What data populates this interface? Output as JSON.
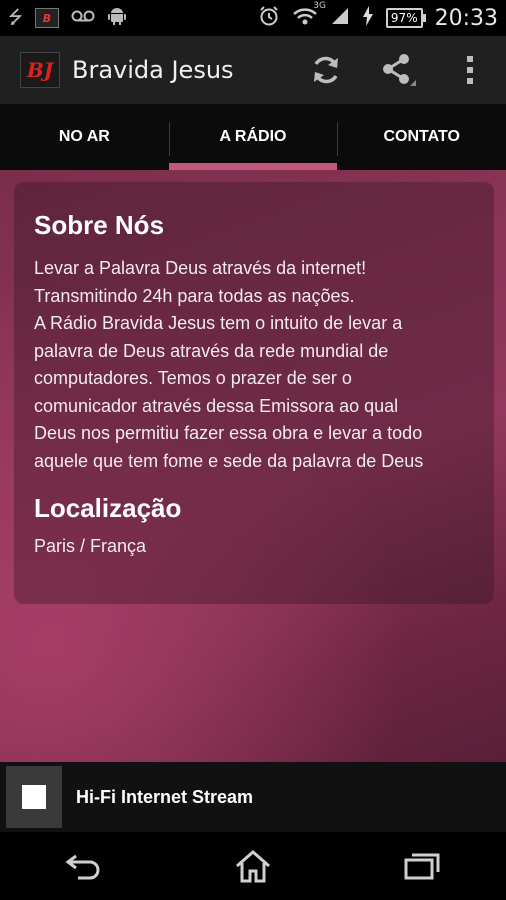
{
  "status_bar": {
    "time": "20:33",
    "battery": "97%",
    "network": "3G",
    "icons_left": [
      "usb-icon",
      "app-notification-icon",
      "voicemail-icon",
      "android-icon"
    ],
    "icons_right": [
      "alarm-icon",
      "wifi-icon",
      "signal-icon",
      "charging-icon",
      "battery-icon"
    ]
  },
  "action_bar": {
    "logo_text": "BJ",
    "title": "Bravida Jesus",
    "actions": [
      "refresh-icon",
      "share-icon",
      "overflow-menu-icon"
    ]
  },
  "tabs": [
    {
      "label": "NO AR",
      "active": false
    },
    {
      "label": "A RÁDIO",
      "active": true
    },
    {
      "label": "CONTATO",
      "active": false
    }
  ],
  "about": {
    "heading": "Sobre Nós",
    "lines": [
      "Levar a Palavra Deus através da internet!",
      "Transmitindo 24h para todas as nações.",
      "A Rádio Bravida Jesus tem o intuito de levar a",
      "palavra de Deus através da rede mundial de",
      "computadores. Temos o prazer de ser o",
      "comunicador através dessa Emissora ao qual",
      "Deus nos permitiu fazer essa obra e levar a todo",
      "aquele que tem fome e sede da palavra de Deus"
    ]
  },
  "location": {
    "heading": "Localização",
    "value": "Paris / França"
  },
  "player": {
    "title": "Hi-Fi Internet Stream",
    "control": "stop-icon"
  },
  "nav": [
    "back-icon",
    "home-icon",
    "recent-apps-icon"
  ],
  "colors": {
    "accent": "#c1577b",
    "background_gradient": [
      "#7a2e4c",
      "#93385c",
      "#5a1f38"
    ]
  }
}
